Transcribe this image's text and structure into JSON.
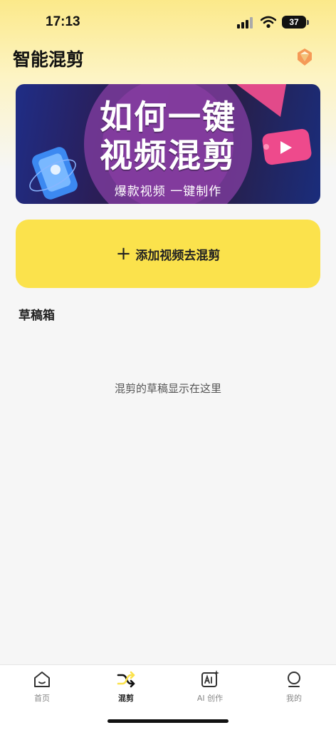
{
  "status_bar": {
    "time": "17:13",
    "battery": "37"
  },
  "header": {
    "title": "智能混剪",
    "vip_icon": "diamond-badge-icon"
  },
  "banner": {
    "title_line1": "如何一键",
    "title_line2": "视频混剪",
    "subtitle": "爆款视频 一键制作"
  },
  "add_button": {
    "label": "添加视频去混剪",
    "icon": "plus-icon"
  },
  "drafts": {
    "title": "草稿箱",
    "empty_text": "混剪的草稿显示在这里"
  },
  "tab_bar": {
    "tabs": [
      {
        "label": "首页",
        "icon": "home-icon",
        "active": false
      },
      {
        "label": "混剪",
        "icon": "shuffle-icon",
        "active": true
      },
      {
        "label": "AI 创作",
        "icon": "ai-create-icon",
        "active": false
      },
      {
        "label": "我的",
        "icon": "profile-icon",
        "active": false
      }
    ]
  },
  "colors": {
    "accent": "#fbe24c",
    "background": "#f6f6f6"
  }
}
